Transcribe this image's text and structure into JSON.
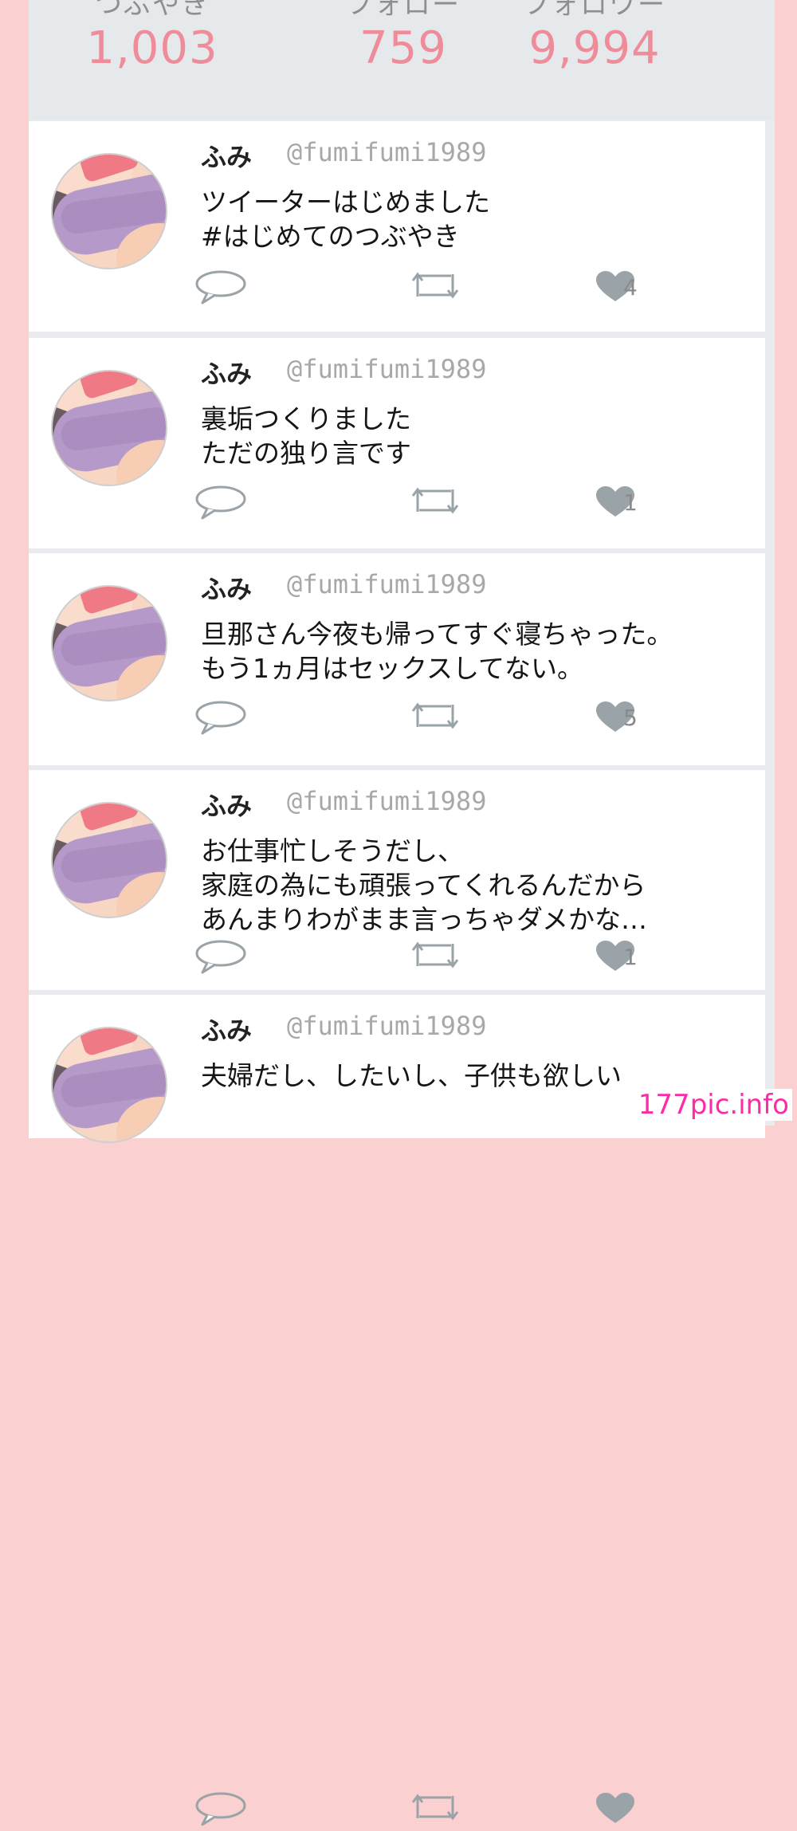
{
  "stats": [
    {
      "label": "つぶやき",
      "value": "1,003"
    },
    {
      "label": "フォロー",
      "value": "759"
    },
    {
      "label": "フォロワー",
      "value": "9,994"
    }
  ],
  "tweets": [
    {
      "name": "ふみ",
      "handle": "@fumifumi1989",
      "lines": [
        "ツイーターはじめました",
        "#はじめてのつぶやき"
      ],
      "likes": "4"
    },
    {
      "name": "ふみ",
      "handle": "@fumifumi1989",
      "lines": [
        "裏垢つくりました",
        "ただの独り言です"
      ],
      "likes": "1"
    },
    {
      "name": "ふみ",
      "handle": "@fumifumi1989",
      "lines": [
        "旦那さん今夜も帰ってすぐ寝ちゃった。",
        "もう1ヵ月はセックスしてない。"
      ],
      "likes": "5"
    },
    {
      "name": "ふみ",
      "handle": "@fumifumi1989",
      "lines": [
        "お仕事忙しそうだし、",
        "家庭の為にも頑張ってくれるんだから",
        "あんまりわがまま言っちゃダメかな…"
      ],
      "likes": "1"
    },
    {
      "name": "ふみ",
      "handle": "@fumifumi1989",
      "lines": [
        "夫婦だし、したいし、子供も欲しい"
      ],
      "likes": ""
    }
  ],
  "icons": {
    "reply": "speech-bubble-icon",
    "retweet": "retweet-icon",
    "like": "heart-icon"
  },
  "colors": {
    "stat_value": "#ef8c9a",
    "icon": "#9aa3a8",
    "page_border": "#fbd0d0",
    "watermark": "#ff2aa6"
  },
  "watermark": "177pic.info"
}
